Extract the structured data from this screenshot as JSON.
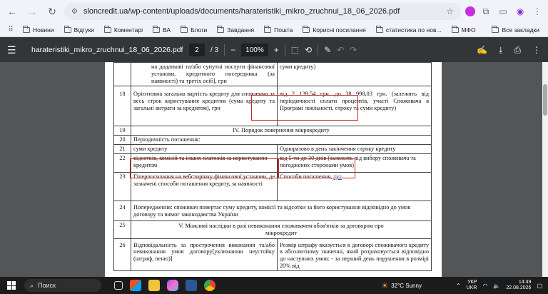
{
  "browser": {
    "url": "sloncredit.ua/wp-content/uploads/documents/harateristiki_mikro_zruchnui_18_06_2026.pdf",
    "bookmarks": [
      "Новини",
      "Відгуки",
      "Коментарі",
      "ВА",
      "Блоги",
      "Завдання",
      "Пошта",
      "Корисні посилання",
      "статистика по нов...",
      "МФО"
    ],
    "all_bookmarks": "Все закладки"
  },
  "pdf": {
    "filename": "harateristiki_mikro_zruchnui_18_06_2026.pdf",
    "page_current": "2",
    "page_total": "/ 3",
    "zoom": "100%"
  },
  "table": {
    "row_top": {
      "c2": "на додаткові та/або супутні послуги фінансової установи, кредитного посередника (за наявності) та третіх осіб], грн",
      "c3": "суми кредиту)"
    },
    "row_18": {
      "n": "18",
      "c2": "Орієнтовна загальна вартість кредиту для споживача за весь строк користування кредитом (сума кредиту та загальні витрати за кредитом), грн",
      "c3": "від 2 139,54 грн. до 38 998,03 грн. (залежить від періодичності сплати процентів, участі Споживача в Програмі лояльності, строку та суми кредиту)"
    },
    "row_19": {
      "n": "19",
      "c2": "IV. Порядок повернення мікрокредиту"
    },
    "row_20": {
      "n": "20",
      "c2": "Періодичність погашення:"
    },
    "row_21": {
      "n": "21",
      "c2": "суми кредиту",
      "c3": "Одноразово в день закінчення строку кредиту"
    },
    "row_22": {
      "n": "22",
      "c2": "відсотків, комісій та інших платежів за користування кредитом",
      "c3": "від 5-ти до 30 днів (залежить від вибору споживача та погоджених сторонами умов)"
    },
    "row_23": {
      "n": "23",
      "c2": "Гіперпосилання на вебсторінку фінансової установи, де зазначені способи погашення кредиту, за наявності",
      "c3_text": "Способи погашення, ",
      "c3_link": "тут"
    },
    "row_24": {
      "n": "24",
      "c2": "Попередження: споживач повертає суму кредиту, комісії та відсотки за його користування відповідно до умов договору та вимог законодавства України"
    },
    "row_25": {
      "n": "25",
      "c2": "V. Можливі наслідки в разі невиконання споживачем обов'язків за договором про мікрокредит"
    },
    "row_26": {
      "n": "26",
      "c2": "Відповідальність за прострочення виконання та/або невиконання умов договору[уключаючи неустойку (штраф, пеню)]",
      "c3": "Розмір штрафу вказується в договорі споживачого кредиту в абсолютному значенні, який розраховується відповідно до наступних умов: - за перший день порушення в розмірі 20% від"
    }
  },
  "taskbar": {
    "search": "Поиск",
    "weather": "32°C  Sunny",
    "lang_top": "УКР",
    "lang_bottom": "UKR",
    "time": "14:49",
    "date": "22.08.2026"
  },
  "colors": {
    "highlight": "#c62828",
    "link": "#1a55c5"
  }
}
